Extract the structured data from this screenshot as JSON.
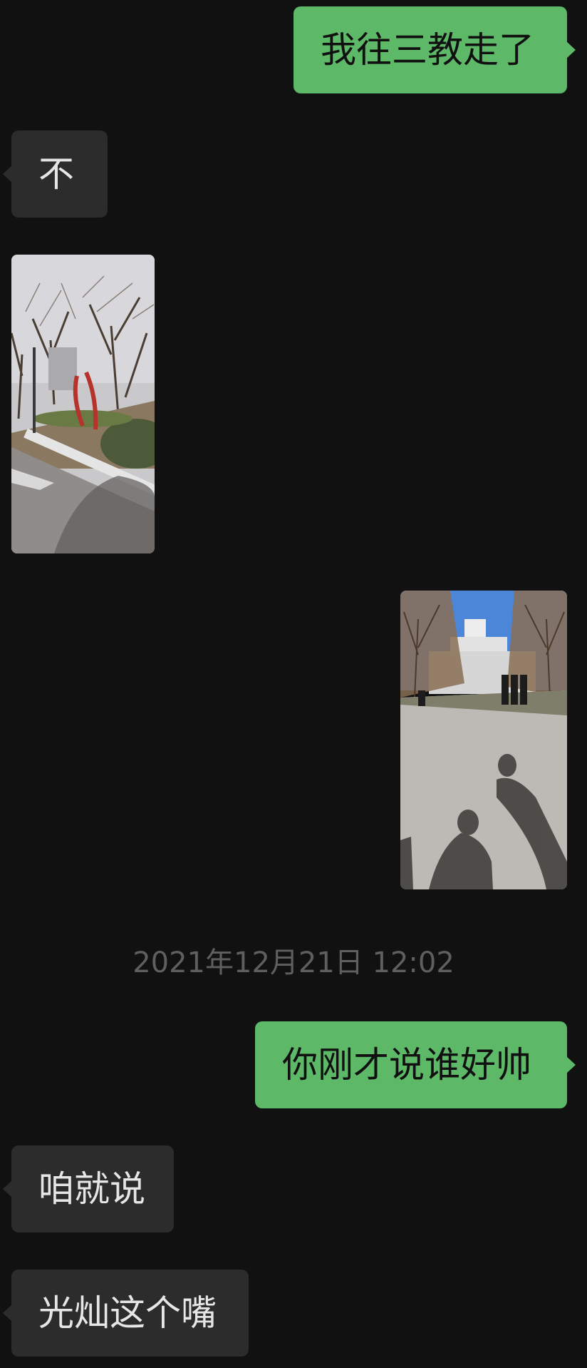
{
  "messages": [
    {
      "direction": "sent",
      "text": "我往三教走了"
    },
    {
      "direction": "received",
      "text": "不"
    },
    {
      "direction": "received",
      "type": "photo",
      "description_icon": "photo-campus-road-icon"
    },
    {
      "direction": "sent",
      "type": "photo",
      "description_icon": "photo-campus-avenue-icon"
    },
    {
      "direction": "sent",
      "text": "你刚才说谁好帅"
    },
    {
      "direction": "received",
      "text": "咱就说"
    },
    {
      "direction": "received",
      "text": "光灿这个嘴"
    }
  ],
  "timestamp": "2021年12月21日 12:02",
  "colors": {
    "background": "#111111",
    "sent_bubble": "#5DB868",
    "received_bubble": "#2C2C2C",
    "timestamp_text": "#5F5F5F"
  }
}
